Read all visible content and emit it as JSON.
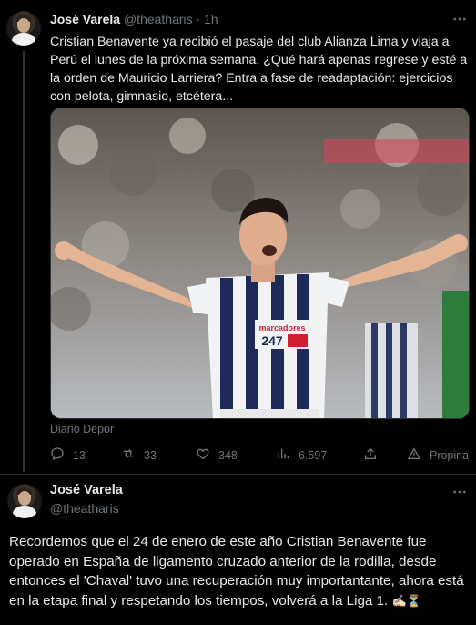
{
  "tweet1": {
    "author_name": "José Varela",
    "author_handle": "@theatharis",
    "time_sep": "·",
    "time": "1h",
    "text": "Cristian Benavente ya recibió el pasaje del club Alianza Lima y viaja a Perú el lunes de la próxima semana.  ¿Qué hará apenas regrese y esté a la orden de Mauricio Larriera?  Entra a fase de readaptación: ejercicios con pelota, gimnasio, etcétera...",
    "media_source": "Diario Depor",
    "media_ad_text": "marcadores",
    "media_ad_number": "247",
    "stats": {
      "replies": "13",
      "reposts": "33",
      "likes": "348",
      "views": "6.597",
      "promote_label": "Propina"
    }
  },
  "tweet2": {
    "author_name": "José Varela",
    "author_handle": "@theatharis",
    "text": "Recordemos que el 24 de enero de este año Cristian Benavente fue operado en España de ligamento cruzado anterior de la rodilla, desde entonces el 'Chaval' tuvo una recuperación muy importantante, ahora está en la etapa final y  respetando los tiempos, volverá a la Liga 1. ",
    "emojis": "✍🏻⏳"
  },
  "icons": {
    "reply": "reply-icon",
    "repost": "repost-icon",
    "like": "heart-icon",
    "views": "views-icon",
    "share": "share-icon",
    "tip": "tip-icon",
    "more": "more-icon"
  },
  "colors": {
    "background": "#000000",
    "text": "#e7e9ea",
    "secondary": "#71767b",
    "border": "#2f3336"
  }
}
